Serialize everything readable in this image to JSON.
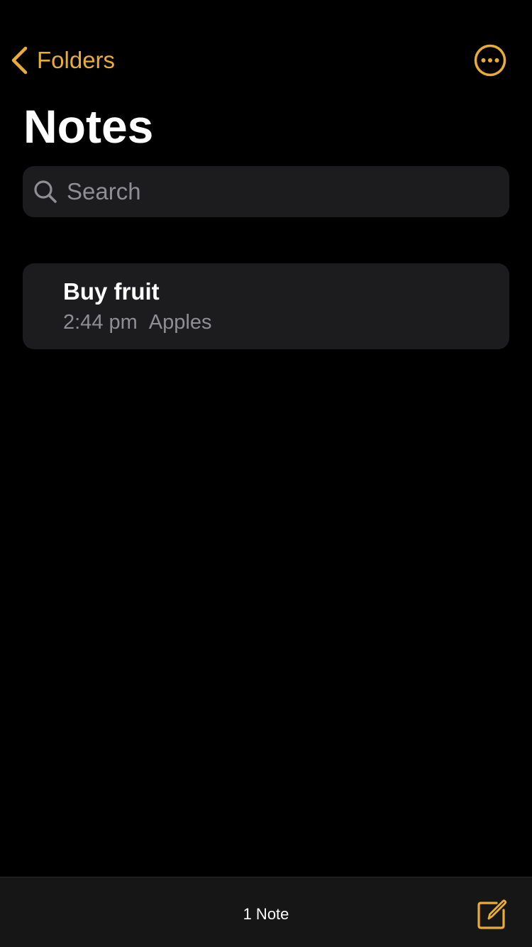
{
  "theme": {
    "accent": "#e9ad33",
    "background": "#000000",
    "card": "#1c1c1e",
    "secondary_text": "#8e8e93"
  },
  "nav": {
    "back_label": "Folders",
    "back_icon": "chevron-left-icon",
    "more_icon": "ellipsis-circle-icon"
  },
  "title": "Notes",
  "search": {
    "placeholder": "Search",
    "value": "",
    "icon": "search-icon"
  },
  "notes": [
    {
      "title": "Buy fruit",
      "time": "2:44 pm",
      "preview": "Apples"
    }
  ],
  "bottom_bar": {
    "count_label": "1 Note",
    "compose_icon": "compose-icon"
  }
}
